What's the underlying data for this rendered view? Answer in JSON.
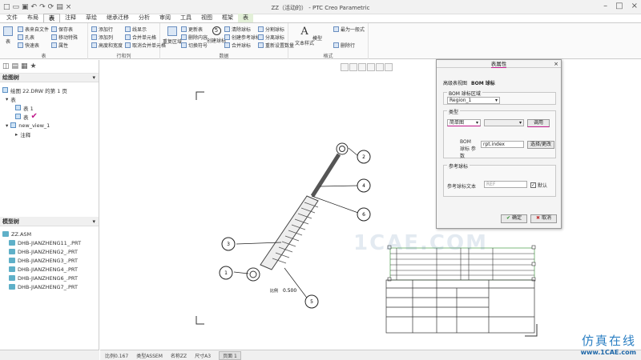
{
  "app": {
    "title": "ZZ（活动的） - PTC Creo Parametric"
  },
  "ribbon": {
    "tabs": [
      {
        "label": "文件",
        "state": "normal"
      },
      {
        "label": "布局",
        "state": "normal"
      },
      {
        "label": "表",
        "state": "active"
      },
      {
        "label": "注释",
        "state": "normal"
      },
      {
        "label": "草绘",
        "state": "normal"
      },
      {
        "label": "继承迁移",
        "state": "normal"
      },
      {
        "label": "分析",
        "state": "normal"
      },
      {
        "label": "审阅",
        "state": "normal"
      },
      {
        "label": "工具",
        "state": "normal"
      },
      {
        "label": "视图",
        "state": "normal"
      },
      {
        "label": "框架",
        "state": "normal"
      },
      {
        "label": "表",
        "state": "green"
      }
    ],
    "groups": {
      "table_label": "表",
      "rows_cols_label": "行和列",
      "data_label": "数据",
      "format_label": "格式"
    },
    "items": {
      "table": "表",
      "table_from_file": "表来自文件",
      "hole_table": "孔表",
      "quick_tables": "快速表",
      "save_table": "保存表",
      "move_special": "移动特殊",
      "attributes": "属性",
      "add_row": "添加行",
      "add_col": "添加列",
      "height_width": "高度和宽度",
      "line_display": "线显示",
      "merge_cells": "合并单元格",
      "unmerge_cells": "取消合并单元格",
      "repeat_region": "重复区域",
      "update_table": "更新表",
      "delete_content": "删除内容",
      "switch_symbol": "切换符号",
      "create_balloons": "创建球标",
      "cleanup_balloons": "清除球标",
      "create_ref_balloon": "创建参考球标",
      "merge_balloons": "合并球标",
      "split_balloons": "分割球标",
      "split_balloons2": "分离球标",
      "reset_qty": "重新设置数量",
      "text_style": "文本样式",
      "mode": "模型",
      "top_text": "最为一般式",
      "clear_cell": "删除行"
    }
  },
  "left_panel": {
    "drawing_tree_title": "绘图树",
    "drawing_tree_root": "绘图 22.DRW 的第 1 页",
    "tree_items": [
      "表",
      "表 1",
      "表",
      "new_view_1",
      "注释"
    ],
    "model_tree_title": "模型树",
    "model_root": "ZZ.ASM",
    "model_items": [
      "DHB-JIANZHENG11_.PRT",
      "DHB-JIANZHENG2_.PRT",
      "DHB-JIANZHENG3_.PRT",
      "DHB-JIANZHENG4_.PRT",
      "DHB-JIANZHENG6_.PRT",
      "DHB-JIANZHENG7_.PRT"
    ]
  },
  "dialog": {
    "title": "表属性",
    "tabs": [
      "高级表视图",
      "BOM 球标"
    ],
    "region_legend": "BOM 球标区域",
    "region_value": "Region_1",
    "type_legend": "类型",
    "type_value": "简单图",
    "type_button": "调用",
    "param_label": "BOM 球标 参数",
    "param_value": "rpt.index",
    "select_button": "选择/更改",
    "ref_legend": "参考球标",
    "ref_text_label": "参考球标文本",
    "ref_text_value": "REF",
    "default_label": "默认",
    "ok_label": "确定",
    "cancel_label": "取消"
  },
  "drawing": {
    "balloons": [
      "1",
      "2",
      "3",
      "4",
      "5",
      "6"
    ],
    "scale_label": "比例",
    "scale_value": "0.500"
  },
  "status": {
    "items": [
      "比例0.167",
      "类型ASSEM",
      "名称ZZ",
      "尺寸A3"
    ],
    "page": "页面 1"
  },
  "watermark": {
    "center": "1CAE.COM",
    "cn": "仿真在线",
    "url": "www.1CAE.com"
  }
}
